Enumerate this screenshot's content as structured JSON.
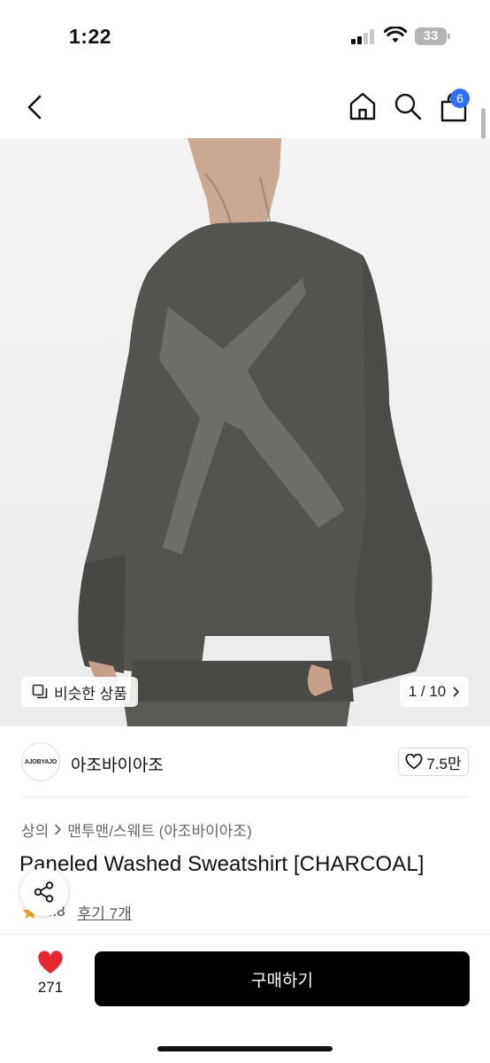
{
  "status_bar": {
    "time": "1:22",
    "battery": "33"
  },
  "nav": {
    "cart_badge": "6"
  },
  "gallery": {
    "similar_label": "비슷한 상품",
    "counter": "1 / 10"
  },
  "brand": {
    "logo_text": "AJOBYAJO",
    "name": "아조바이아조",
    "likes": "7.5만"
  },
  "breadcrumb": {
    "category": "상의",
    "subcategory": "맨투맨/스웨트 (아조바이아조)"
  },
  "product": {
    "title": "Paneled Washed Sweatshirt [CHARCOAL]",
    "rating": "4.8",
    "reviews": "후기 7개"
  },
  "bottom_bar": {
    "wish_count": "271",
    "buy_label": "구매하기"
  },
  "colors": {
    "accent_blue": "#2f6fff",
    "heart_red": "#e8262f",
    "buy_bg": "#000000",
    "star": "#f5a623"
  },
  "icons": [
    "back-icon",
    "home-icon",
    "search-icon",
    "cart-icon",
    "similar-icon",
    "chevron-right-icon",
    "heart-outline-icon",
    "share-icon",
    "star-icon",
    "heart-filled-icon"
  ]
}
